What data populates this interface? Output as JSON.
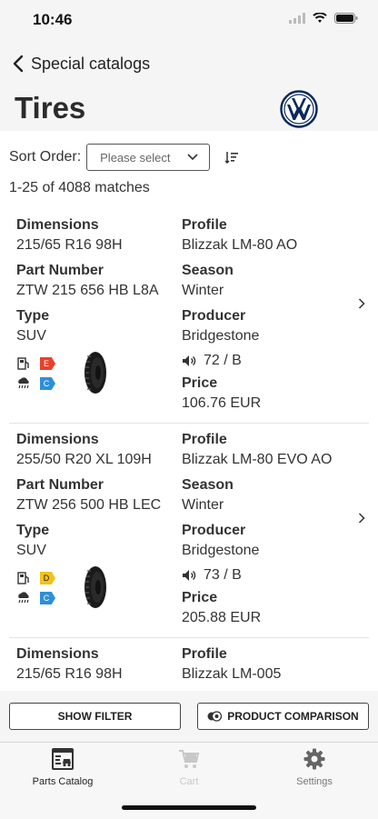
{
  "status": {
    "time": "10:46"
  },
  "nav": {
    "back_label": "Special catalogs"
  },
  "page": {
    "title": "Tires"
  },
  "sort": {
    "label": "Sort Order:",
    "placeholder": "Please select"
  },
  "results": {
    "matches": "1-25 of 4088 matches"
  },
  "items": [
    {
      "dimensions_label": "Dimensions",
      "dimensions": "215/65 R16 98H",
      "part_label": "Part Number",
      "part_number": "ZTW 215 656 HB L8A",
      "type_label": "Type",
      "type": "SUV",
      "profile_label": "Profile",
      "profile": "Blizzak LM-80 AO",
      "season_label": "Season",
      "season": "Winter",
      "producer_label": "Producer",
      "producer": "Bridgestone",
      "noise": "72 / B",
      "price_label": "Price",
      "price": "106.76 EUR",
      "fuel_class": "E",
      "fuel_color": "#e8412c",
      "wet_class": "C",
      "wet_color": "#2f8fd8"
    },
    {
      "dimensions_label": "Dimensions",
      "dimensions": "255/50 R20 XL 109H",
      "part_label": "Part Number",
      "part_number": "ZTW 256 500 HB LEC",
      "type_label": "Type",
      "type": "SUV",
      "profile_label": "Profile",
      "profile": "Blizzak LM-80 EVO AO",
      "season_label": "Season",
      "season": "Winter",
      "producer_label": "Producer",
      "producer": "Bridgestone",
      "noise": "73 / B",
      "price_label": "Price",
      "price": "205.88 EUR",
      "fuel_class": "D",
      "fuel_color": "#f1c21b",
      "wet_class": "C",
      "wet_color": "#2f8fd8"
    },
    {
      "dimensions_label": "Dimensions",
      "dimensions": "215/65 R16 98H",
      "profile_label": "Profile",
      "profile": "Blizzak LM-005"
    }
  ],
  "buttons": {
    "filter": "SHOW FILTER",
    "compare": "PRODUCT COMPARISON"
  },
  "tabs": [
    {
      "label": "Parts Catalog",
      "icon": "parts-catalog-icon",
      "active": true
    },
    {
      "label": "Cart",
      "icon": "cart-icon",
      "active": false
    },
    {
      "label": "Settings",
      "icon": "gear-icon",
      "active": false
    }
  ]
}
